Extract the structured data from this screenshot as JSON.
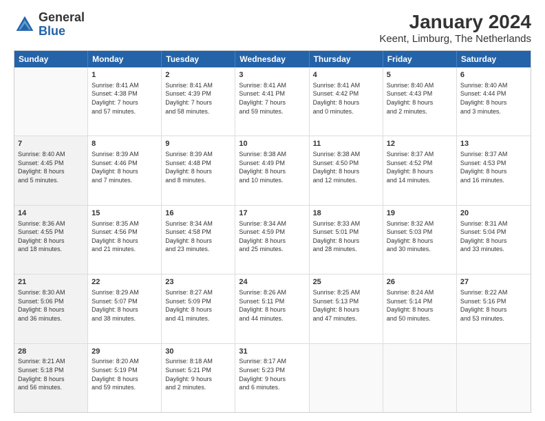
{
  "header": {
    "logo_general": "General",
    "logo_blue": "Blue",
    "main_title": "January 2024",
    "subtitle": "Keent, Limburg, The Netherlands"
  },
  "calendar": {
    "days": [
      "Sunday",
      "Monday",
      "Tuesday",
      "Wednesday",
      "Thursday",
      "Friday",
      "Saturday"
    ],
    "rows": [
      [
        {
          "day": "",
          "empty": true
        },
        {
          "day": "1",
          "line1": "Sunrise: 8:41 AM",
          "line2": "Sunset: 4:38 PM",
          "line3": "Daylight: 7 hours",
          "line4": "and 57 minutes."
        },
        {
          "day": "2",
          "line1": "Sunrise: 8:41 AM",
          "line2": "Sunset: 4:39 PM",
          "line3": "Daylight: 7 hours",
          "line4": "and 58 minutes."
        },
        {
          "day": "3",
          "line1": "Sunrise: 8:41 AM",
          "line2": "Sunset: 4:41 PM",
          "line3": "Daylight: 7 hours",
          "line4": "and 59 minutes."
        },
        {
          "day": "4",
          "line1": "Sunrise: 8:41 AM",
          "line2": "Sunset: 4:42 PM",
          "line3": "Daylight: 8 hours",
          "line4": "and 0 minutes."
        },
        {
          "day": "5",
          "line1": "Sunrise: 8:40 AM",
          "line2": "Sunset: 4:43 PM",
          "line3": "Daylight: 8 hours",
          "line4": "and 2 minutes."
        },
        {
          "day": "6",
          "line1": "Sunrise: 8:40 AM",
          "line2": "Sunset: 4:44 PM",
          "line3": "Daylight: 8 hours",
          "line4": "and 3 minutes."
        }
      ],
      [
        {
          "day": "7",
          "line1": "Sunrise: 8:40 AM",
          "line2": "Sunset: 4:45 PM",
          "line3": "Daylight: 8 hours",
          "line4": "and 5 minutes.",
          "shaded": true
        },
        {
          "day": "8",
          "line1": "Sunrise: 8:39 AM",
          "line2": "Sunset: 4:46 PM",
          "line3": "Daylight: 8 hours",
          "line4": "and 7 minutes."
        },
        {
          "day": "9",
          "line1": "Sunrise: 8:39 AM",
          "line2": "Sunset: 4:48 PM",
          "line3": "Daylight: 8 hours",
          "line4": "and 8 minutes."
        },
        {
          "day": "10",
          "line1": "Sunrise: 8:38 AM",
          "line2": "Sunset: 4:49 PM",
          "line3": "Daylight: 8 hours",
          "line4": "and 10 minutes."
        },
        {
          "day": "11",
          "line1": "Sunrise: 8:38 AM",
          "line2": "Sunset: 4:50 PM",
          "line3": "Daylight: 8 hours",
          "line4": "and 12 minutes."
        },
        {
          "day": "12",
          "line1": "Sunrise: 8:37 AM",
          "line2": "Sunset: 4:52 PM",
          "line3": "Daylight: 8 hours",
          "line4": "and 14 minutes."
        },
        {
          "day": "13",
          "line1": "Sunrise: 8:37 AM",
          "line2": "Sunset: 4:53 PM",
          "line3": "Daylight: 8 hours",
          "line4": "and 16 minutes."
        }
      ],
      [
        {
          "day": "14",
          "line1": "Sunrise: 8:36 AM",
          "line2": "Sunset: 4:55 PM",
          "line3": "Daylight: 8 hours",
          "line4": "and 18 minutes.",
          "shaded": true
        },
        {
          "day": "15",
          "line1": "Sunrise: 8:35 AM",
          "line2": "Sunset: 4:56 PM",
          "line3": "Daylight: 8 hours",
          "line4": "and 21 minutes."
        },
        {
          "day": "16",
          "line1": "Sunrise: 8:34 AM",
          "line2": "Sunset: 4:58 PM",
          "line3": "Daylight: 8 hours",
          "line4": "and 23 minutes."
        },
        {
          "day": "17",
          "line1": "Sunrise: 8:34 AM",
          "line2": "Sunset: 4:59 PM",
          "line3": "Daylight: 8 hours",
          "line4": "and 25 minutes."
        },
        {
          "day": "18",
          "line1": "Sunrise: 8:33 AM",
          "line2": "Sunset: 5:01 PM",
          "line3": "Daylight: 8 hours",
          "line4": "and 28 minutes."
        },
        {
          "day": "19",
          "line1": "Sunrise: 8:32 AM",
          "line2": "Sunset: 5:03 PM",
          "line3": "Daylight: 8 hours",
          "line4": "and 30 minutes."
        },
        {
          "day": "20",
          "line1": "Sunrise: 8:31 AM",
          "line2": "Sunset: 5:04 PM",
          "line3": "Daylight: 8 hours",
          "line4": "and 33 minutes."
        }
      ],
      [
        {
          "day": "21",
          "line1": "Sunrise: 8:30 AM",
          "line2": "Sunset: 5:06 PM",
          "line3": "Daylight: 8 hours",
          "line4": "and 36 minutes.",
          "shaded": true
        },
        {
          "day": "22",
          "line1": "Sunrise: 8:29 AM",
          "line2": "Sunset: 5:07 PM",
          "line3": "Daylight: 8 hours",
          "line4": "and 38 minutes."
        },
        {
          "day": "23",
          "line1": "Sunrise: 8:27 AM",
          "line2": "Sunset: 5:09 PM",
          "line3": "Daylight: 8 hours",
          "line4": "and 41 minutes."
        },
        {
          "day": "24",
          "line1": "Sunrise: 8:26 AM",
          "line2": "Sunset: 5:11 PM",
          "line3": "Daylight: 8 hours",
          "line4": "and 44 minutes."
        },
        {
          "day": "25",
          "line1": "Sunrise: 8:25 AM",
          "line2": "Sunset: 5:13 PM",
          "line3": "Daylight: 8 hours",
          "line4": "and 47 minutes."
        },
        {
          "day": "26",
          "line1": "Sunrise: 8:24 AM",
          "line2": "Sunset: 5:14 PM",
          "line3": "Daylight: 8 hours",
          "line4": "and 50 minutes."
        },
        {
          "day": "27",
          "line1": "Sunrise: 8:22 AM",
          "line2": "Sunset: 5:16 PM",
          "line3": "Daylight: 8 hours",
          "line4": "and 53 minutes."
        }
      ],
      [
        {
          "day": "28",
          "line1": "Sunrise: 8:21 AM",
          "line2": "Sunset: 5:18 PM",
          "line3": "Daylight: 8 hours",
          "line4": "and 56 minutes.",
          "shaded": true
        },
        {
          "day": "29",
          "line1": "Sunrise: 8:20 AM",
          "line2": "Sunset: 5:19 PM",
          "line3": "Daylight: 8 hours",
          "line4": "and 59 minutes."
        },
        {
          "day": "30",
          "line1": "Sunrise: 8:18 AM",
          "line2": "Sunset: 5:21 PM",
          "line3": "Daylight: 9 hours",
          "line4": "and 2 minutes."
        },
        {
          "day": "31",
          "line1": "Sunrise: 8:17 AM",
          "line2": "Sunset: 5:23 PM",
          "line3": "Daylight: 9 hours",
          "line4": "and 6 minutes."
        },
        {
          "day": "",
          "empty": true
        },
        {
          "day": "",
          "empty": true
        },
        {
          "day": "",
          "empty": true
        }
      ]
    ]
  }
}
